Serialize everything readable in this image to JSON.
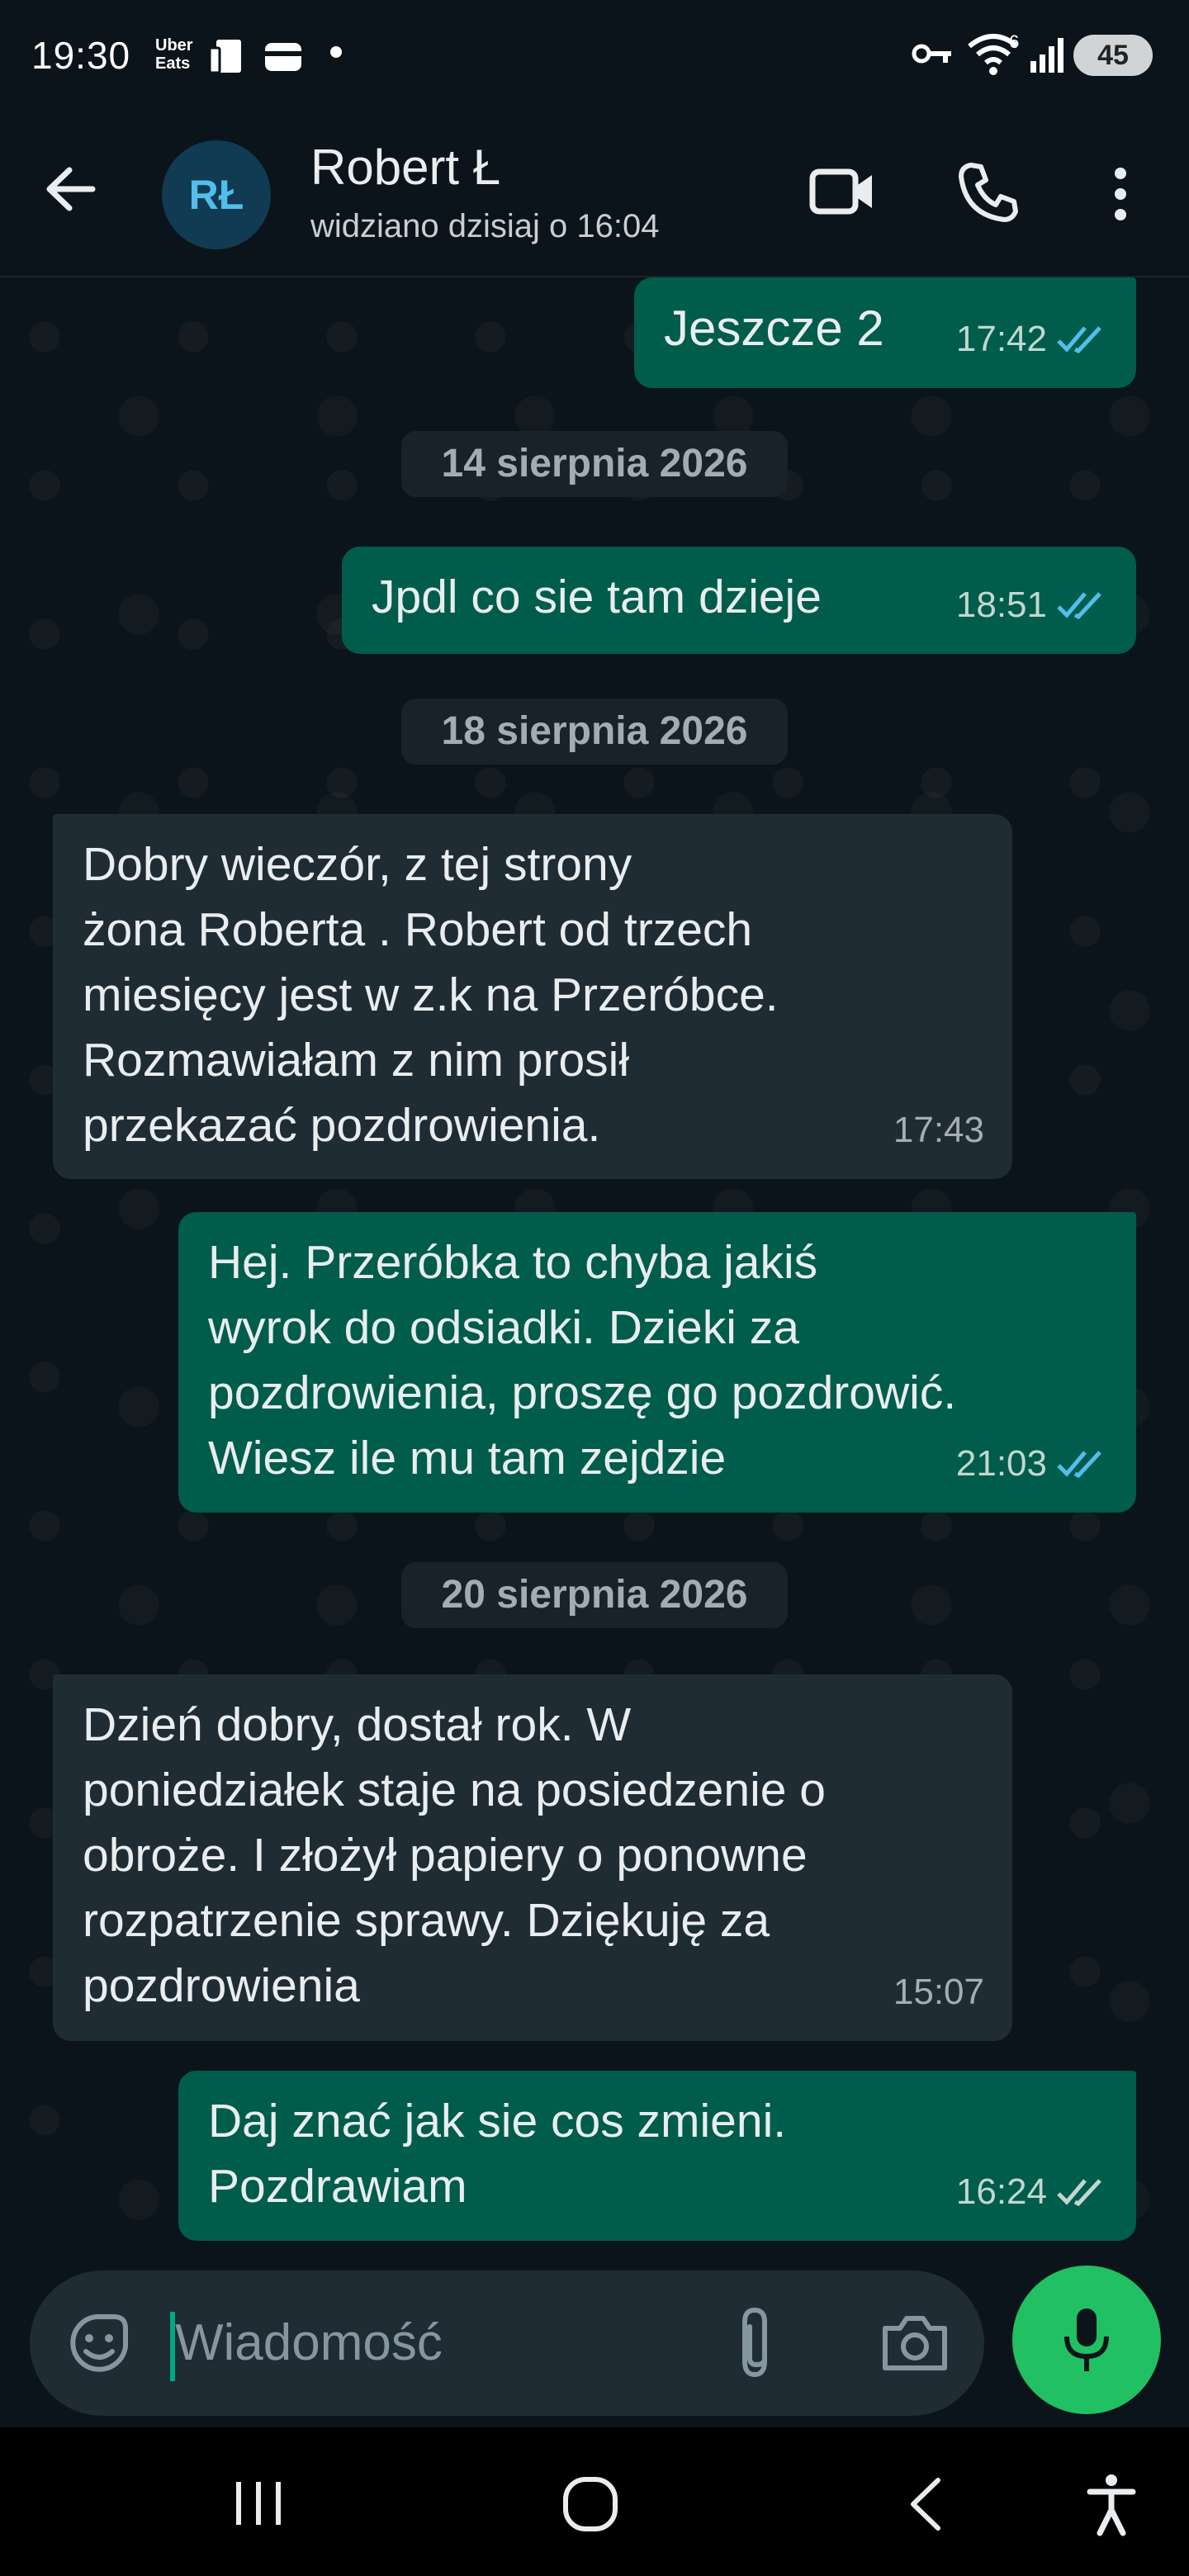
{
  "status_bar": {
    "time": "19:30",
    "uber_line1": "Uber",
    "uber_line2": "Eats",
    "wifi_label": "6",
    "battery": "45"
  },
  "header": {
    "avatar_initials": "RŁ",
    "contact_name": "Robert Ł",
    "last_seen": "widziano dzisiaj o 16:04"
  },
  "messages": [
    {
      "type": "out",
      "text": "Jeszcze 2",
      "time": "17:42",
      "read": true
    },
    {
      "type": "date",
      "text": "14 sierpnia 2026"
    },
    {
      "type": "out",
      "text": "Jpdl co sie tam dzieje",
      "time": "18:51",
      "read": true
    },
    {
      "type": "date",
      "text": "18 sierpnia 2026"
    },
    {
      "type": "in",
      "lines": [
        "Dobry wieczór,  z tej strony",
        "żona Roberta . Robert od trzech",
        "miesięcy jest w z.k na Przeróbce.",
        "Rozmawiałam z nim prosił",
        "przekazać pozdrowienia."
      ],
      "time": "17:43"
    },
    {
      "type": "out",
      "lines": [
        "Hej. Przeróbka to chyba jakiś",
        "wyrok do odsiadki. Dzieki za",
        "pozdrowienia, proszę go pozdrowić.",
        "Wiesz ile mu tam zejdzie"
      ],
      "time": "21:03",
      "read": true
    },
    {
      "type": "date",
      "text": "20 sierpnia 2026"
    },
    {
      "type": "in",
      "lines": [
        "Dzień dobry,  dostał rok.  W",
        "poniedziałek staje na posiedzenie o",
        "obroże.  I złożył papiery o ponowne",
        "rozpatrzenie sprawy.  Dziękuję za",
        "pozdrowienia"
      ],
      "time": "15:07"
    },
    {
      "type": "out",
      "lines": [
        "Daj znać jak sie cos zmieni.",
        "Pozdrawiam"
      ],
      "time": "16:24",
      "read": false
    }
  ],
  "composer": {
    "placeholder": "Wiadomość"
  },
  "colors": {
    "background": "#0b141a",
    "outgoing_bubble": "#005c4b",
    "incoming_bubble": "#202c33",
    "accent_green": "#21c063",
    "read_tick_blue": "#53bdeb"
  }
}
